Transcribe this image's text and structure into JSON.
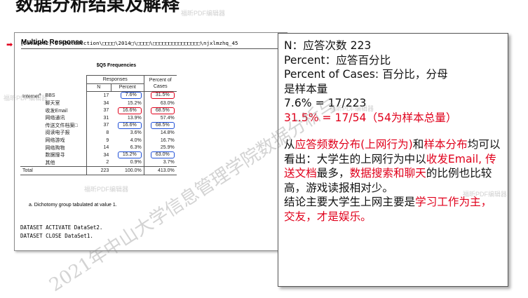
{
  "slide_title": "数据分析结果及解释",
  "spss": {
    "header": "Multiple Response",
    "dataset_line": "[DataSet2] D:\\DataSection\\□□□□\\2014□\\□□□□\\□□□□□□□□□□□□□□□\\njxlmzhq_45",
    "table_title": "$Q5 Frequencies",
    "col_responses": "Responses",
    "col_n": "N",
    "col_percent": "Percent",
    "col_percent_of_cases": "Percent of Cases",
    "group_label": "Internet",
    "group_sup": "a",
    "rows": [
      {
        "label": "BBS",
        "n": "17",
        "pct": "7.6%",
        "cases": "31.5%"
      },
      {
        "label": "聊天室",
        "n": "34",
        "pct": "15.2%",
        "cases": "63.0%"
      },
      {
        "label": "收发Email",
        "n": "37",
        "pct": "16.6%",
        "cases": "68.5%"
      },
      {
        "label": "网络通讯",
        "n": "31",
        "pct": "13.9%",
        "cases": "57.4%"
      },
      {
        "label": "传送文件档案□",
        "n": "37",
        "pct": "16.6%",
        "cases": "68.5%"
      },
      {
        "label": "阅读电子报",
        "n": "8",
        "pct": "3.6%",
        "cases": "14.8%"
      },
      {
        "label": "网络游戏",
        "n": "9",
        "pct": "4.0%",
        "cases": "16.7%"
      },
      {
        "label": "网络购物",
        "n": "14",
        "pct": "6.3%",
        "cases": "25.9%"
      },
      {
        "label": "数据搜寻",
        "n": "34",
        "pct": "15.2%",
        "cases": "63.0%"
      },
      {
        "label": "其他",
        "n": "2",
        "pct": "0.9%",
        "cases": "3.7%"
      }
    ],
    "total_label": "Total",
    "total_n": "223",
    "total_pct": "100.0%",
    "total_cases": "413.0%",
    "footnote": "a. Dichotomy group tabulated at value 1.",
    "syntax1": "DATASET ACTIVATE DataSet2.",
    "syntax2": "DATASET CLOSE DataSet1."
  },
  "notes": {
    "l1": "N：应答次数 223",
    "l2": "Percent：应答百分比",
    "l3a": "Percent of Cases: 百分比，分母",
    "l3b": "是样本量",
    "l4": "7.6% = 17/223",
    "l5": "31.5% = 17/54（54为样本总量）",
    "p2_a": "从",
    "p2_b": "应答频数分布(上网行为)",
    "p2_c": "和",
    "p2_d": "样本分布",
    "p2_e": "均可以看出：大学生的上网行为中以",
    "p2_f": "收发Email, 传送文档",
    "p2_g": "最多，",
    "p2_h": "数据搜索和聊天",
    "p2_i": "的比例也比较高，游戏读报相对少。",
    "p3_a": "结论主要大学生上网主要是",
    "p3_b": "学习工作为主，交友，才是娱乐。"
  },
  "watermark": "2021年中山大学信息管理学院数据分析与",
  "watermark_small": "福昕PDF编辑器",
  "colors": {
    "accent_red": "#e0001b",
    "accent_blue": "#1f4fd6"
  }
}
